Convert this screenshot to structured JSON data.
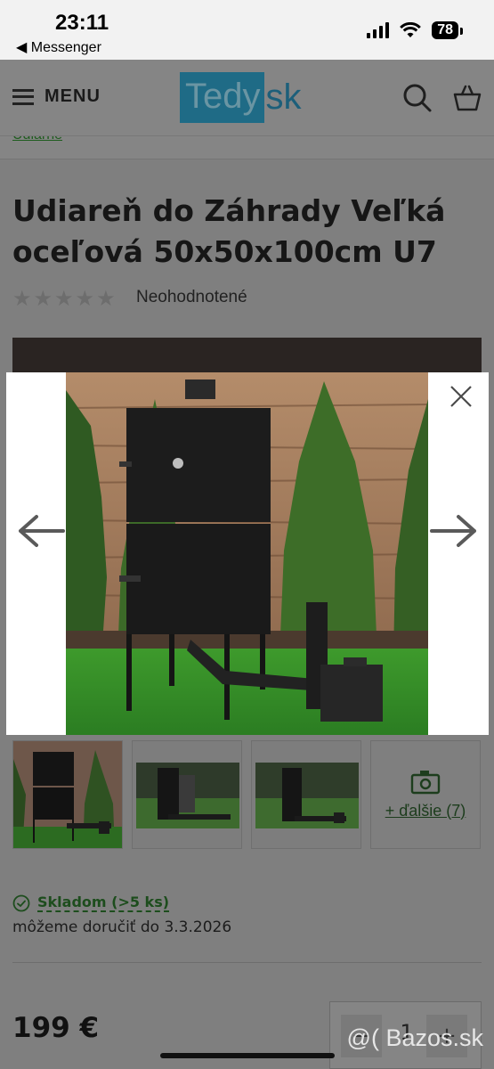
{
  "status_bar": {
    "time": "23:11",
    "back_app": "◀ Messenger",
    "battery": "78"
  },
  "header": {
    "menu_label": "MENU",
    "logo_left": "Tedy",
    "logo_right": "sk",
    "icons": [
      "search-icon",
      "basket-icon",
      "hamburger-icon"
    ]
  },
  "breadcrumb": {
    "label": "Udiarne"
  },
  "product": {
    "title": "Udiareň do Záhrady Veľká oceľová 50x50x100cm U7",
    "rating_text": "Neohodnotené",
    "stars": [
      "★",
      "★",
      "★",
      "★",
      "★"
    ]
  },
  "thumbnails": {
    "more_label": "+ ďalšie (7)"
  },
  "availability": {
    "stock_label": "Skladom (>5 ks)",
    "delivery_text": "môžeme doručiť do 3.3.2026"
  },
  "purchase": {
    "price": "199 €",
    "quantity": "1",
    "minus_label": "−",
    "plus_label": "+"
  },
  "watermark": "@( Bazos.sk",
  "colors": {
    "brand_blue": "#2aa3d6",
    "stock_green": "#1d4d1d",
    "overlay_grey": "#7f7f7f"
  }
}
